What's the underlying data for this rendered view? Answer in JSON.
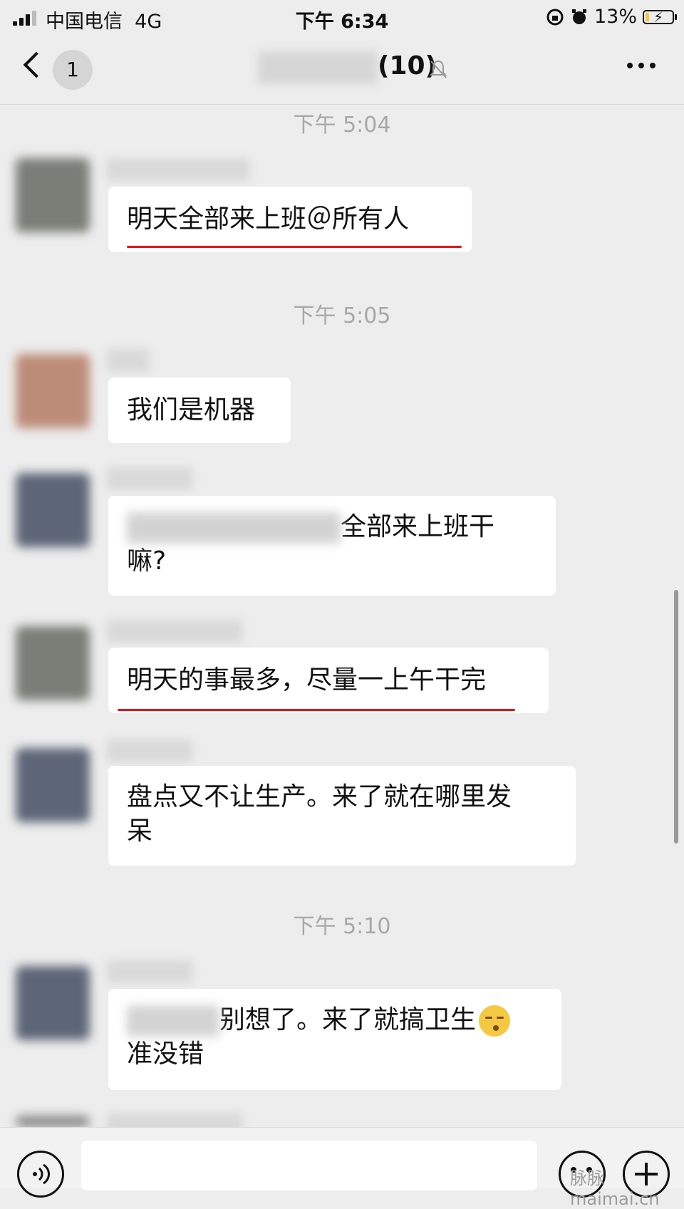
{
  "status_bar": {
    "carrier": "中国电信",
    "network": "4G",
    "time": "下午 6:34",
    "battery": "13%",
    "battery_level": 0.13
  },
  "nav": {
    "unread_count": "1",
    "member_count": "(10)"
  },
  "messages": [
    {
      "timestamp": "下午 5:04",
      "text": "明天全部来上班＠所有人",
      "underlined": true
    },
    {
      "timestamp": "下午 5:05",
      "text": "我们是机器"
    },
    {
      "text_part1": "全部来上班干",
      "text_part2": "嘛?"
    },
    {
      "text": "明天的事最多，尽量一上午干完",
      "underlined": true
    },
    {
      "text_part1": "盘点又不让生产。来了就在哪里发",
      "text_part2": "呆"
    },
    {
      "timestamp": "下午 5:10",
      "text_part1": "别想了。来了就搞卫生",
      "text_part2": "准没错",
      "emoji": "shushing-face"
    }
  ],
  "colors": {
    "background": "#ededed",
    "bubble": "#ffffff",
    "underline": "#e8141a",
    "timestamp": "#a8a8a8"
  },
  "watermark": "脉脉 maimai.cn"
}
